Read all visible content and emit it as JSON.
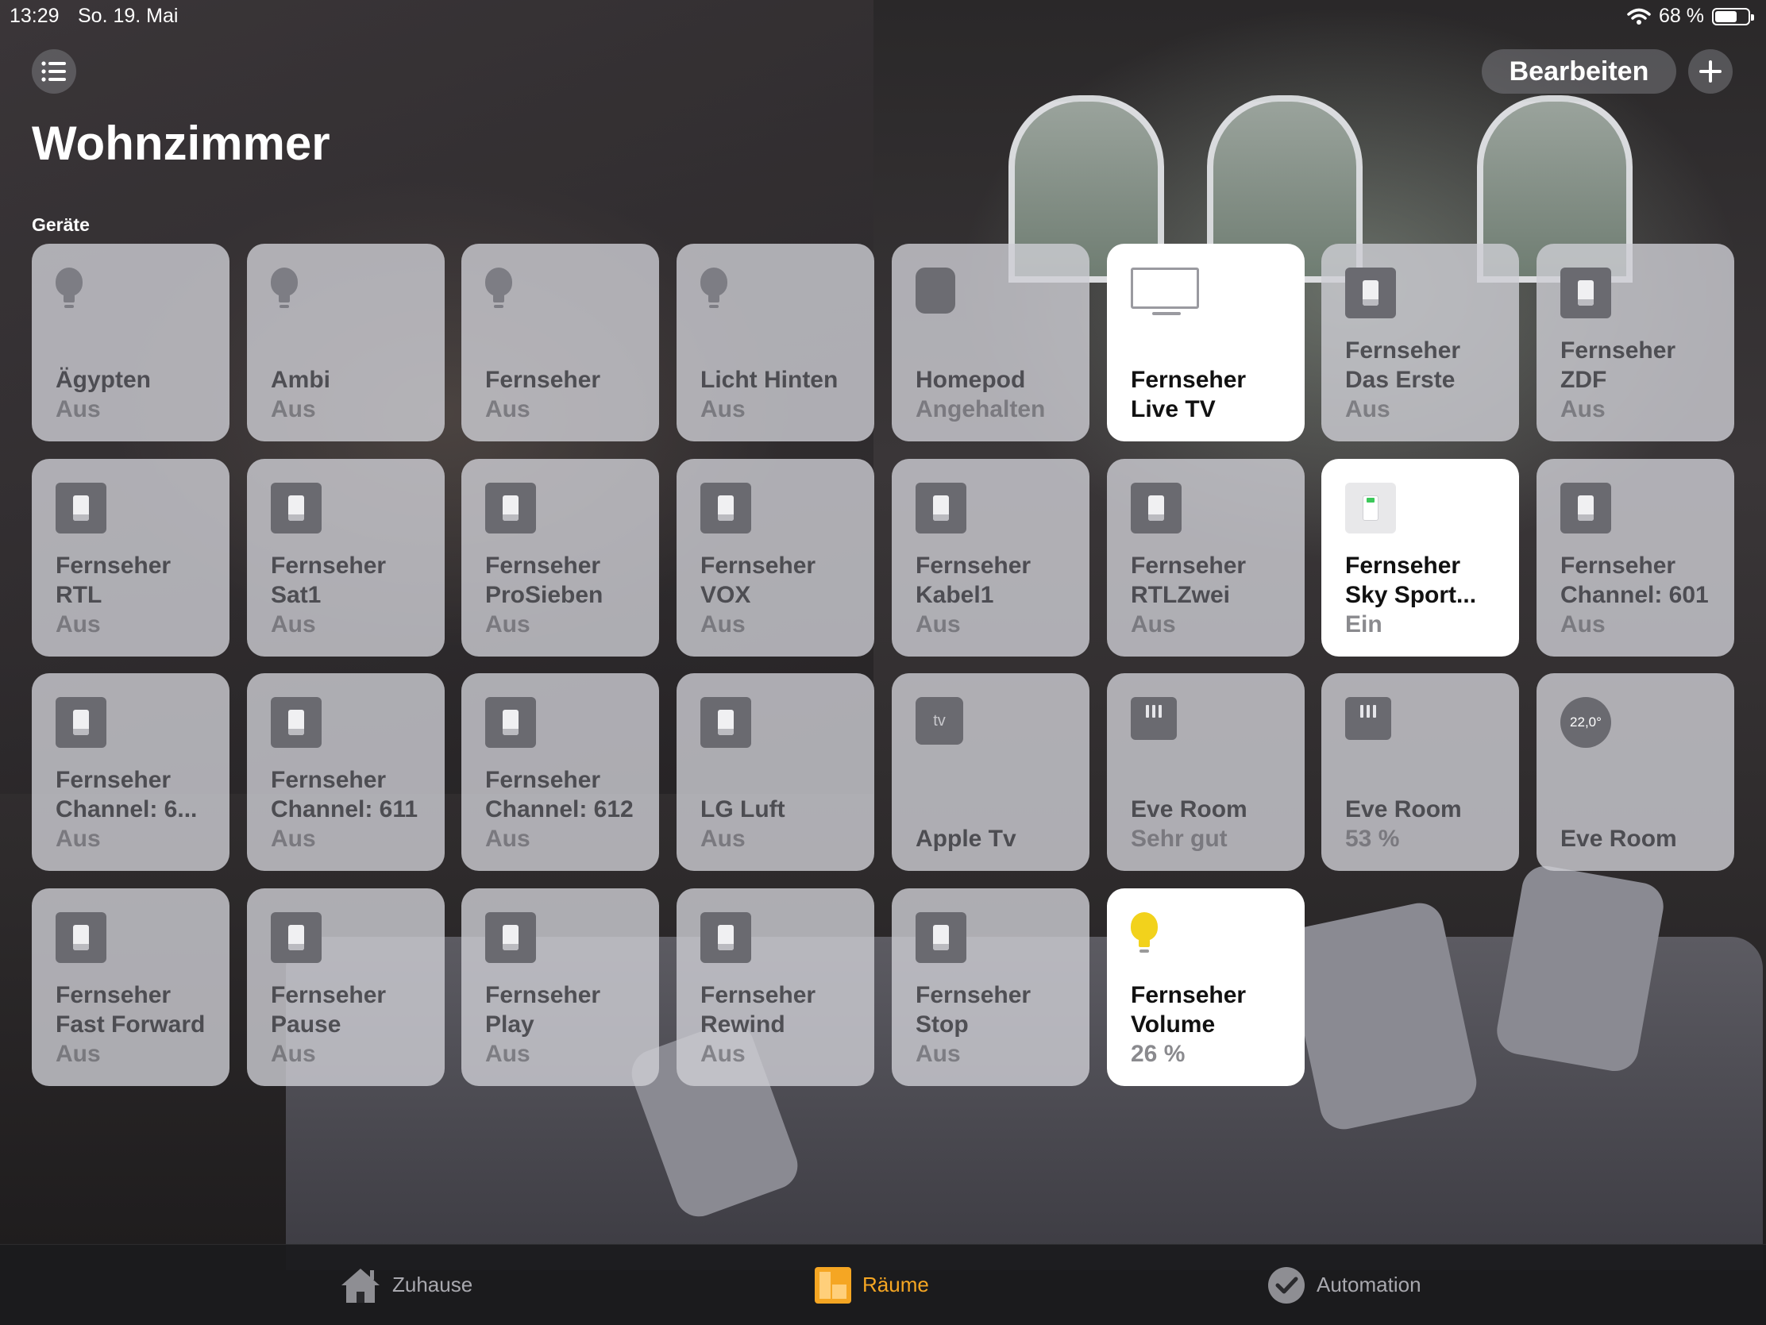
{
  "status_bar": {
    "time": "13:29",
    "date": "So. 19. Mai",
    "battery_text": "68 %",
    "battery_level": 0.68
  },
  "header": {
    "title": "Wohnzimmer",
    "edit_label": "Bearbeiten",
    "list_icon": "list-icon",
    "add_icon": "plus-icon"
  },
  "section_label": "Geräte",
  "accent_color": "#f5a623",
  "tiles": [
    {
      "name": "Ägypten",
      "state": "Aus",
      "icon": "lightbulb-icon",
      "on": false
    },
    {
      "name": "Ambi",
      "state": "Aus",
      "icon": "lightbulb-icon",
      "on": false
    },
    {
      "name": "Fernseher",
      "state": "Aus",
      "icon": "lightbulb-icon",
      "on": false
    },
    {
      "name": "Licht Hinten",
      "state": "Aus",
      "icon": "lightbulb-icon",
      "on": false
    },
    {
      "name": "Homepod",
      "state": "Angehalten",
      "icon": "homepod-icon",
      "on": false
    },
    {
      "name": "Fernseher",
      "name2": "Live TV",
      "state": "",
      "icon": "tv-icon",
      "on": true
    },
    {
      "name": "Fernseher",
      "name2": "Das Erste",
      "state": "Aus",
      "icon": "switch-icon",
      "on": false
    },
    {
      "name": "Fernseher",
      "name2": "ZDF",
      "state": "Aus",
      "icon": "switch-icon",
      "on": false
    },
    {
      "name": "Fernseher",
      "name2": "RTL",
      "state": "Aus",
      "icon": "switch-icon",
      "on": false
    },
    {
      "name": "Fernseher",
      "name2": "Sat1",
      "state": "Aus",
      "icon": "switch-icon",
      "on": false
    },
    {
      "name": "Fernseher",
      "name2": "ProSieben",
      "state": "Aus",
      "icon": "switch-icon",
      "on": false
    },
    {
      "name": "Fernseher",
      "name2": "VOX",
      "state": "Aus",
      "icon": "switch-icon",
      "on": false
    },
    {
      "name": "Fernseher",
      "name2": "Kabel1",
      "state": "Aus",
      "icon": "switch-icon",
      "on": false
    },
    {
      "name": "Fernseher",
      "name2": "RTLZwei",
      "state": "Aus",
      "icon": "switch-icon",
      "on": false
    },
    {
      "name": "Fernseher",
      "name2": "Sky Sport...",
      "state": "Ein",
      "icon": "switch-icon",
      "on": true
    },
    {
      "name": "Fernseher",
      "name2": "Channel: 601",
      "state": "Aus",
      "icon": "switch-icon",
      "on": false
    },
    {
      "name": "Fernseher",
      "name2": "Channel: 6...",
      "state": "Aus",
      "icon": "switch-icon",
      "on": false
    },
    {
      "name": "Fernseher",
      "name2": "Channel: 611",
      "state": "Aus",
      "icon": "switch-icon",
      "on": false
    },
    {
      "name": "Fernseher",
      "name2": "Channel: 612",
      "state": "Aus",
      "icon": "switch-icon",
      "on": false
    },
    {
      "name": "LG Luft",
      "state": "Aus",
      "icon": "switch-icon",
      "on": false
    },
    {
      "name": "Apple Tv",
      "state": "",
      "icon": "apple-tv-icon",
      "icon_text": "tv",
      "on": false
    },
    {
      "name": "Eve Room",
      "state": "Sehr gut",
      "icon": "air-quality-icon",
      "on": false
    },
    {
      "name": "Eve Room",
      "state": "53 %",
      "icon": "humidity-icon",
      "on": false
    },
    {
      "name": "Eve Room",
      "state": "",
      "icon": "thermometer-icon",
      "icon_text": "22,0°",
      "on": false
    },
    {
      "name": "Fernseher",
      "name2": "Fast Forward",
      "state": "Aus",
      "icon": "switch-icon",
      "on": false
    },
    {
      "name": "Fernseher",
      "name2": "Pause",
      "state": "Aus",
      "icon": "switch-icon",
      "on": false
    },
    {
      "name": "Fernseher",
      "name2": "Play",
      "state": "Aus",
      "icon": "switch-icon",
      "on": false
    },
    {
      "name": "Fernseher",
      "name2": "Rewind",
      "state": "Aus",
      "icon": "switch-icon",
      "on": false
    },
    {
      "name": "Fernseher",
      "name2": "Stop",
      "state": "Aus",
      "icon": "switch-icon",
      "on": false
    },
    {
      "name": "Fernseher",
      "name2": "Volume",
      "state": "26 %",
      "icon": "lightbulb-icon",
      "on": true
    }
  ],
  "tabbar": {
    "tabs": [
      {
        "label": "Zuhause",
        "icon": "house-icon",
        "active": false
      },
      {
        "label": "Räume",
        "icon": "rooms-icon",
        "active": true
      },
      {
        "label": "Automation",
        "icon": "automation-check-icon",
        "active": false
      }
    ]
  }
}
